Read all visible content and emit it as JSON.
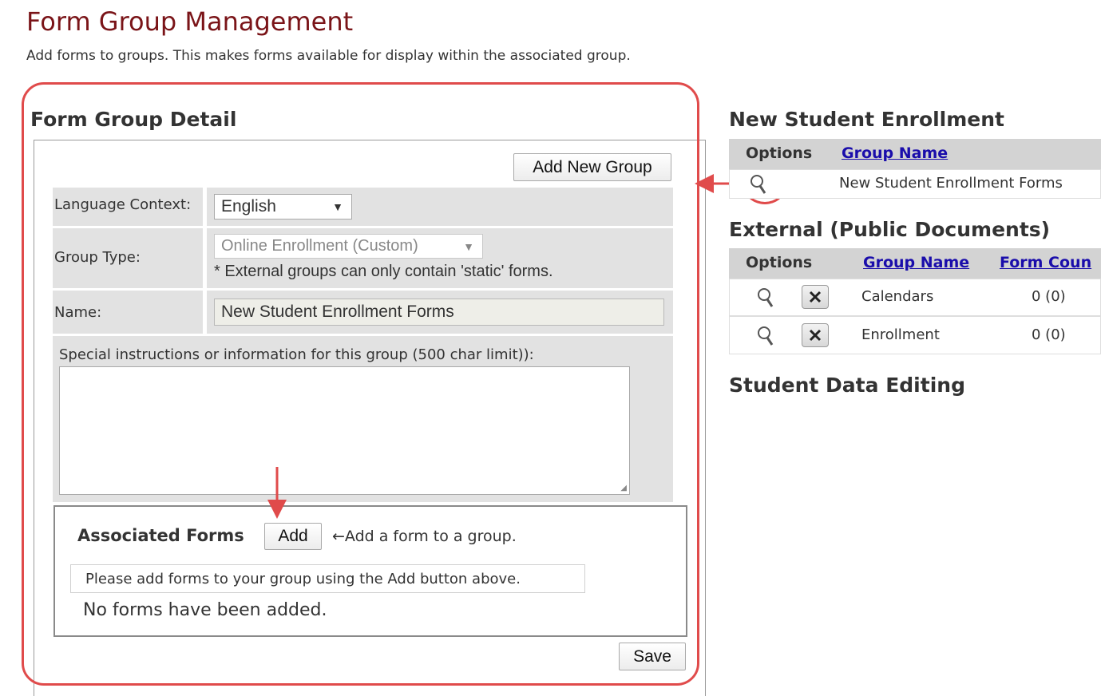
{
  "header": {
    "title": "Form Group Management",
    "subtitle": "Add forms to groups. This makes forms available for display within the associated group."
  },
  "detail": {
    "title": "Form Group Detail",
    "add_new_group_label": "Add New Group",
    "language_label": "Language Context:",
    "language_value": "English",
    "group_type_label": "Group Type:",
    "group_type_value": "Online Enrollment (Custom)",
    "group_type_note": "* External groups can only contain 'static' forms.",
    "name_label": "Name:",
    "name_value": "New Student Enrollment Forms",
    "instructions_label": "Special instructions or information for this group (500 char limit)):",
    "instructions_value": "",
    "associated": {
      "title": "Associated Forms",
      "add_label": "Add",
      "add_hint": "←Add a form to a group.",
      "notice": "Please add forms to your group using the Add button above.",
      "empty": "No forms have been added."
    },
    "save_label": "Save"
  },
  "new_student": {
    "title": "New Student Enrollment",
    "col_options": "Options",
    "col_group_name": "Group Name",
    "rows": [
      {
        "name": "New Student Enrollment Forms"
      }
    ]
  },
  "external": {
    "title": "External (Public Documents)",
    "col_options": "Options",
    "col_group_name": "Group Name",
    "col_form_count": "Form Coun",
    "rows": [
      {
        "name": "Calendars",
        "count": "0 (0)"
      },
      {
        "name": "Enrollment",
        "count": "0 (0)"
      }
    ]
  },
  "student_data": {
    "title": "Student Data Editing"
  },
  "colors": {
    "title": "#7a1418",
    "highlight": "#e04b4b",
    "link": "#1a0dab"
  }
}
